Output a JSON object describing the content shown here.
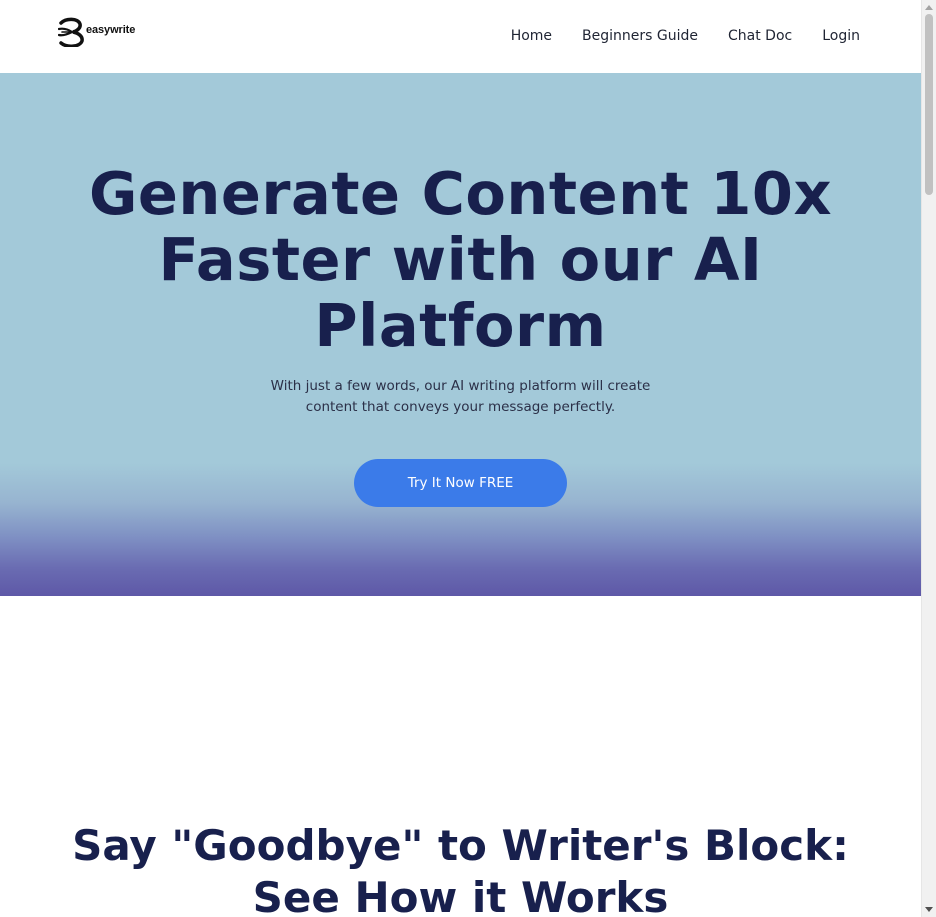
{
  "brand": {
    "name": "easywrite",
    "logo_icon": "easywrite-logo-icon"
  },
  "nav": {
    "links": [
      "Home",
      "Beginners Guide",
      "Chat Doc",
      "Login"
    ]
  },
  "hero": {
    "title": "Generate Content 10x Faster with our AI Platform",
    "subtitle": "With just a few words, our AI writing platform will create content that conveys your message perfectly.",
    "cta_label": "Try It Now FREE"
  },
  "section": {
    "title": "Say \"Goodbye\" to Writer's Block: See How it Works"
  },
  "colors": {
    "hero_bg": "#a3c9d9",
    "hero_gradient_end": "#5e58a7",
    "heading": "#18204d",
    "cta_bg": "#3b7be9"
  }
}
